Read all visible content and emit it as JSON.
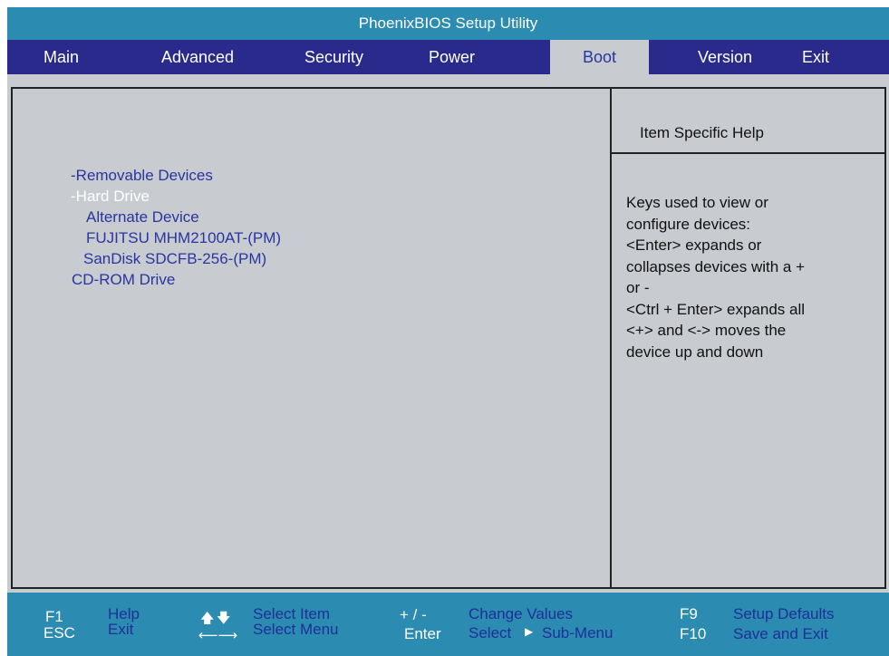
{
  "window": {
    "title": "PhoenixBIOS Setup Utility"
  },
  "menu": {
    "items": [
      "Main",
      "Advanced",
      "Security",
      "Power",
      "Boot",
      "Version",
      "Exit"
    ],
    "active": "Boot"
  },
  "boot_list": [
    {
      "label": "-Removable Devices",
      "selected": false
    },
    {
      "label": "-Hard Drive",
      "selected": true
    },
    {
      "label": "Alternate Device",
      "selected": false
    },
    {
      "label": "FUJITSU MHM2100AT-(PM)",
      "selected": false
    },
    {
      "label": "SanDisk SDCFB-256-(PM)",
      "selected": false
    },
    {
      "label": "CD-ROM Drive",
      "selected": false
    }
  ],
  "help_panel": {
    "title": "Item Specific Help",
    "lines": [
      "Keys used to view or",
      "configure devices:",
      "<Enter> expands or",
      "collapses devices with a +",
      "or -",
      "<Ctrl + Enter> expands all",
      "<+> and <-> moves the",
      "device up and down"
    ]
  },
  "status_bar": {
    "f1_key": "F1",
    "f1_desc": "Help",
    "esc_key": "ESC",
    "esc_desc": "Exit",
    "updown_desc": "Select Item",
    "leftright_desc": "Select Menu",
    "plusminus_key": "+ / -",
    "plusminus_desc": "Change Values",
    "enter_key": "Enter",
    "enter_desc_1": "Select",
    "enter_desc_2": "Sub-Menu",
    "f9_key": "F9",
    "f9_desc": "Setup Defaults",
    "f10_key": "F10",
    "f10_desc": "Save and Exit"
  },
  "colors": {
    "title_bar": "#2b8bb0",
    "menu_bar": "#2a2a8c",
    "panel": "#c8cbd0",
    "item_text": "#2a35a0",
    "selected_text": "#ffffff"
  }
}
